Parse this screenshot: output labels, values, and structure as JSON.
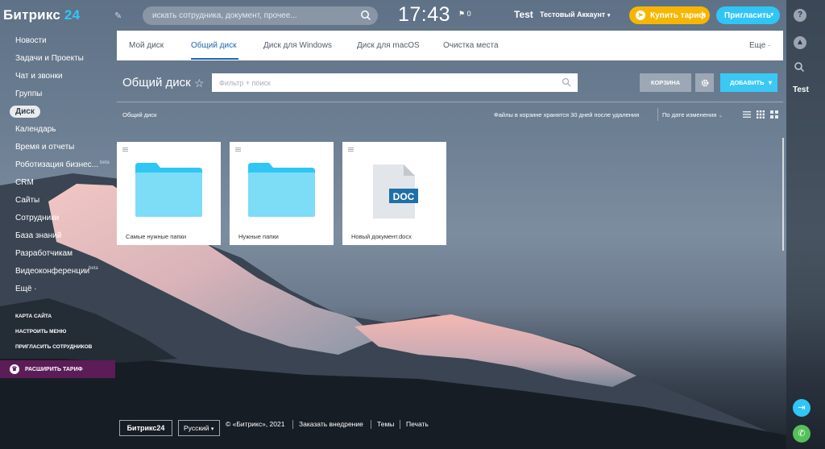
{
  "header": {
    "logo_text": "Битрикс",
    "logo_num": "24",
    "search_placeholder": "искать сотрудника, документ, прочее...",
    "clock": "17:43",
    "flag_count": "0",
    "company_logo": "Test",
    "account_name": "Тестовый Аккаунт",
    "buy_label": "Купить тариф",
    "invite_label": "Пригласить"
  },
  "sidebar": {
    "items": [
      {
        "label": "Новости"
      },
      {
        "label": "Задачи и Проекты"
      },
      {
        "label": "Чат и звонки"
      },
      {
        "label": "Группы"
      },
      {
        "label": "Диск"
      },
      {
        "label": "Календарь"
      },
      {
        "label": "Время и отчеты"
      },
      {
        "label": "Роботизация бизнес..."
      },
      {
        "label": "CRM"
      },
      {
        "label": "Сайты"
      },
      {
        "label": "Сотрудники"
      },
      {
        "label": "База знаний"
      },
      {
        "label": "Разработчикам"
      },
      {
        "label": "Видеоконференции"
      },
      {
        "label": "Ещё ·"
      }
    ],
    "beta_1": "beta",
    "beta_2": "beta",
    "sitemap": "КАРТА САЙТА",
    "configure": "НАСТРОИТЬ МЕНЮ",
    "invite": "ПРИГЛАСИТЬ СОТРУДНИКОВ",
    "upgrade": "РАСШИРИТЬ ТАРИФ"
  },
  "tabs": [
    {
      "label": "Мой диск"
    },
    {
      "label": "Общий диск"
    },
    {
      "label": "Диск для Windows"
    },
    {
      "label": "Диск для macOS"
    },
    {
      "label": "Очистка места"
    }
  ],
  "tabs_more": "Еще ·",
  "toolbar": {
    "title": "Общий диск",
    "filter_placeholder": "Фильтр + поиск",
    "trash_label": "КОРЗИНА",
    "add_label": "ДОБАВИТЬ"
  },
  "subbar": {
    "breadcrumb": "Общий диск",
    "trash_note": "Файлы в корзине хранятся 30 дней после удаления",
    "sort": "По дате изменения"
  },
  "files": [
    {
      "name": "Самые нужные папки",
      "type": "folder"
    },
    {
      "name": "Нужные папки",
      "type": "folder"
    },
    {
      "name": "Новый документ.docx",
      "type": "doc",
      "badge": "DOC"
    }
  ],
  "footer": {
    "logo": "Битрикс24",
    "language": "Русский",
    "copyright": "© «Битрикс», 2021",
    "order": "Заказать внедрение",
    "themes": "Темы",
    "print": "Печать"
  },
  "right_rail": {
    "help_icon": "?",
    "bell_icon": "bell-icon",
    "search_icon": "search-icon",
    "test_label": "Test"
  },
  "colors": {
    "accent": "#2fc6f6",
    "buy": "#f6b600",
    "upgrade": "#5c1c57",
    "link": "#2067b0",
    "folder": "#7ddcf6",
    "doc_badge": "#1f6fa8"
  }
}
